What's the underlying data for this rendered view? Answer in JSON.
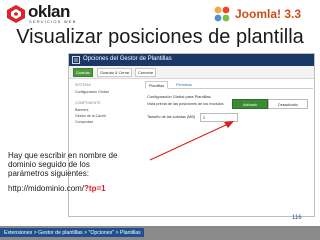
{
  "brand": {
    "name": "oklan",
    "tagline": "SERVICIOS WEB",
    "logo_icon": "oklan-logo-icon"
  },
  "badge": {
    "text": "Joomla! 3.3",
    "icon": "joomla-logo-icon"
  },
  "slide": {
    "title": "Visualizar posiciones de plantilla",
    "page_number": "116"
  },
  "screenshot": {
    "header_title": "Opciones del Gestor de Plantillas",
    "header_icon": "options-icon",
    "toolbar": {
      "save": "Guardar",
      "save_close": "Guardar & Cerrar",
      "cancel": "Cancelar"
    },
    "sidebar": {
      "section_system": "SISTEMA",
      "global_config": "Configuración Global",
      "section_component": "COMPONENTE",
      "items": [
        "Banners",
        "Gestor de la Caché",
        "Comprobar"
      ]
    },
    "tabs": {
      "active": "Plantillas",
      "inactive": "Permisos"
    },
    "form_heading": "Configuración Global para Plantillas",
    "preview_label": "Vista previa de las posiciones de los módulos",
    "toggle_on": "Activado",
    "toggle_off": "Desactivado",
    "upload_label": "Tamaño de las subidas (MB)",
    "upload_value": "2"
  },
  "note": {
    "lines": [
      "Hay que escribir en nombre de",
      "dominio seguido de los",
      "parámetros siguientes:"
    ],
    "url_base": "http://midominio.com/",
    "url_param": "?tp=1"
  },
  "footer": {
    "path": "Extensiones > Gestor de plantillas > \"Opciones\" > Plantillas"
  },
  "colors": {
    "accent_blue": "#1f4f8f",
    "highlight_red": "#e01b1b",
    "toggle_green": "#3c8a33",
    "joomla_orange": "#d04c17"
  }
}
